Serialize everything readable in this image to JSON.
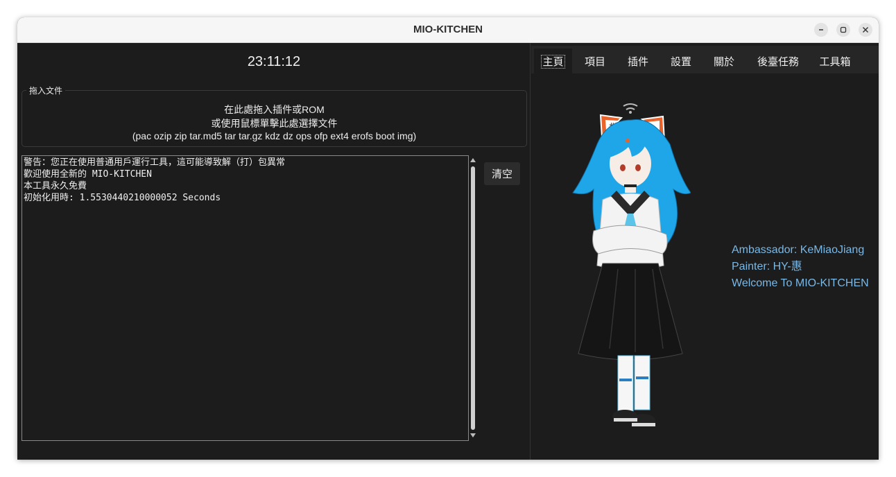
{
  "window": {
    "title": "MIO-KITCHEN"
  },
  "left": {
    "clock": "23:11:12",
    "drop_frame": {
      "legend": "拖入文件",
      "line1": "在此處拖入插件或ROM",
      "line2": "或使用鼠標單擊此處選擇文件",
      "line3": "(pac ozip zip tar.md5 tar tar.gz kdz dz ops ofp ext4 erofs boot img)"
    },
    "console_lines": [
      "警告：您正在使用普通用戶運行工具，這可能導致解（打）包異常",
      "歡迎使用全新的 MIO-KITCHEN",
      "本工具永久免費",
      "初始化用時: 1.5530440210000052 Seconds"
    ],
    "clear_label": "清空"
  },
  "tabs": [
    "主頁",
    "項目",
    "插件",
    "設置",
    "關於",
    "後臺任務",
    "工具箱"
  ],
  "credits": {
    "ambassador": "Ambassador: KeMiaoJiang",
    "painter": "Painter: HY-惠",
    "welcome": "Welcome To MIO-KITCHEN"
  },
  "colors": {
    "accent": "#7ab8e6",
    "background": "#1c1c1c",
    "tabbar": "#262626",
    "hair": "#1fa6e8"
  },
  "icons": [
    "minimize-icon",
    "maximize-icon",
    "close-icon",
    "scroll-up-icon",
    "scroll-down-icon"
  ]
}
